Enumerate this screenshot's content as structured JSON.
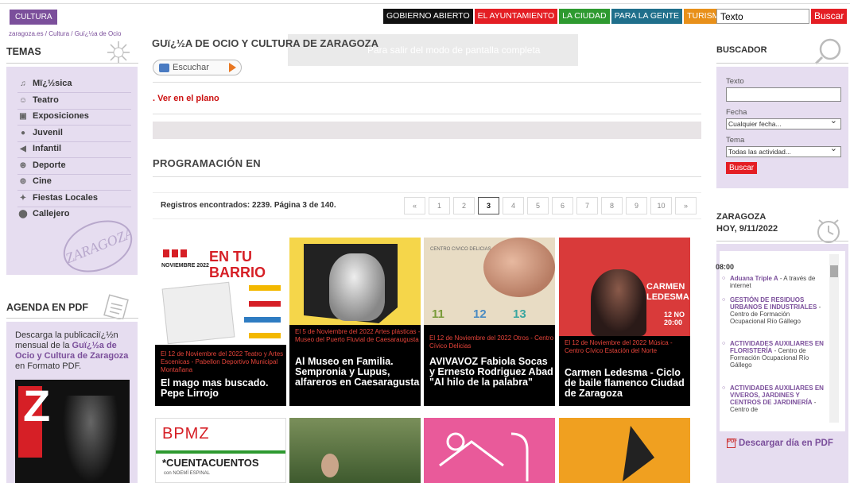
{
  "header": {
    "section_tag": "CULTURA",
    "nav": [
      {
        "label": "GOBIERNO ABIERTO",
        "color": "#111111"
      },
      {
        "label": "EL AYUNTAMIENTO",
        "color": "#e41e24"
      },
      {
        "label": "LA CIUDAD",
        "color": "#2e9a30"
      },
      {
        "label": "PARA LA GENTE",
        "color": "#1f6f8b"
      },
      {
        "label": "TURISMO",
        "color": "#e8901a"
      }
    ],
    "search_value": "Texto",
    "search_button": "Buscar"
  },
  "breadcrumb": "zaragoza.es / Cultura / Guï¿½a de Ocio",
  "sidebar": {
    "title": "TEMAS",
    "items": [
      {
        "label": "Mï¿½sica",
        "icon": "music-icon"
      },
      {
        "label": "Teatro",
        "icon": "theater-icon"
      },
      {
        "label": "Exposiciones",
        "icon": "picture-icon"
      },
      {
        "label": "Juvenil",
        "icon": "youth-icon"
      },
      {
        "label": "Infantil",
        "icon": "child-icon"
      },
      {
        "label": "Deporte",
        "icon": "ball-icon"
      },
      {
        "label": "Cine",
        "icon": "film-icon"
      },
      {
        "label": "Fiestas Locales",
        "icon": "party-icon"
      },
      {
        "label": "Callejero",
        "icon": "pin-icon"
      }
    ],
    "stamp_text": "ZARAGOZA",
    "agenda_title": "AGENDA EN PDF",
    "agenda_text_1": "Descarga la publicaciï¿½n mensual de la ",
    "agenda_text_link": "Guï¿½a de Ocio y Cultura de Zaragoza",
    "agenda_text_2": " en Formato PDF."
  },
  "main": {
    "title": "GUï¿½A DE OCIO Y CULTURA DE ZARAGOZA",
    "fullscreen_hint": "Para salir del modo de pantalla completa",
    "listen_label": "Escuchar",
    "map_link": ". Ver en el plano",
    "programacion_title": "PROGRAMACIÓN EN",
    "records_text": "Registros encontrados: 2239. Página 3 de 140.",
    "pager": [
      "«",
      "1",
      "2",
      "3",
      "4",
      "5",
      "6",
      "7",
      "8",
      "9",
      "10",
      "»"
    ],
    "current_page": "3",
    "cards": [
      {
        "meta": "El 12 de Noviembre del 2022 Teatro y Artes Escenicas - Pabellon Deportivo Municipal Montañana",
        "title": "El mago mas buscado. Pepe Lirrojo",
        "img_top_text": "EN TU BARRIO",
        "img_sub": "NOVIEMBRE 2022",
        "color": "#ffffff"
      },
      {
        "meta": "El 5 de Noviembre del 2022 Artes plásticas - Museo del Puerto Fluvial de Caesaraugusta",
        "title": "Al Museo en Familia. Sempronia y Lupus, alfareros en Caesaragusta",
        "color": "#f5d64a"
      },
      {
        "meta": "El 12 de Noviembre del 2022 Otros - Centro Cívico Delicias",
        "title": "AVIVAVOZ Fabiola Socas y Ernesto Rodriguez Abad \"Al hilo de la palabra\"",
        "img_top_text": "CENTRO CIVICO DELICIAS",
        "color": "#e8dcc4"
      },
      {
        "meta": "El 12 de Noviembre del 2022 Música - Centro Cívico Estación del Norte",
        "title": "Carmen Ledesma - Ciclo de baile flamenco Ciudad de Zaragoza",
        "img_top_text": "CARMEN LEDESMA",
        "img_sub": "12 NO 20:00",
        "color": "#d93a3a"
      }
    ],
    "row2": [
      {
        "img_top_text": "BPMZ",
        "img_sub": "*CUENTACUENTOS",
        "img_note": "con NOEMÍ ESPINAL"
      },
      {},
      {},
      {}
    ]
  },
  "right": {
    "buscador_title": "BUSCADOR",
    "texto_label": "Texto",
    "fecha_label": "Fecha",
    "fecha_value": "Cualquier fecha...",
    "tema_label": "Tema",
    "tema_value": "Todas las actividad...",
    "buscar": "Buscar",
    "hoy_title_1": "ZARAGOZA",
    "hoy_title_2": "HOY, 9/11/2022",
    "time": "08:00",
    "items": [
      {
        "bold": "Aduana Triple A",
        "rest": " - A través de internet"
      },
      {
        "bold": "GESTIÓN DE RESIDUOS URBANOS E INDUSTRIALES",
        "rest": " - Centro de Formación Ocupacional Río Gállego"
      },
      {
        "bold": "ACTIVIDADES AUXILIARES EN FLORISTERÍA",
        "rest": " - Centro de Formación Ocupacional Río Gállego"
      },
      {
        "bold": "ACTIVIDADES AUXILIARES EN VIVEROS, JARDINES Y CENTROS DE JARDINERÍA",
        "rest": " - Centro de"
      }
    ],
    "pdf_label": "Descargar día en PDF"
  }
}
